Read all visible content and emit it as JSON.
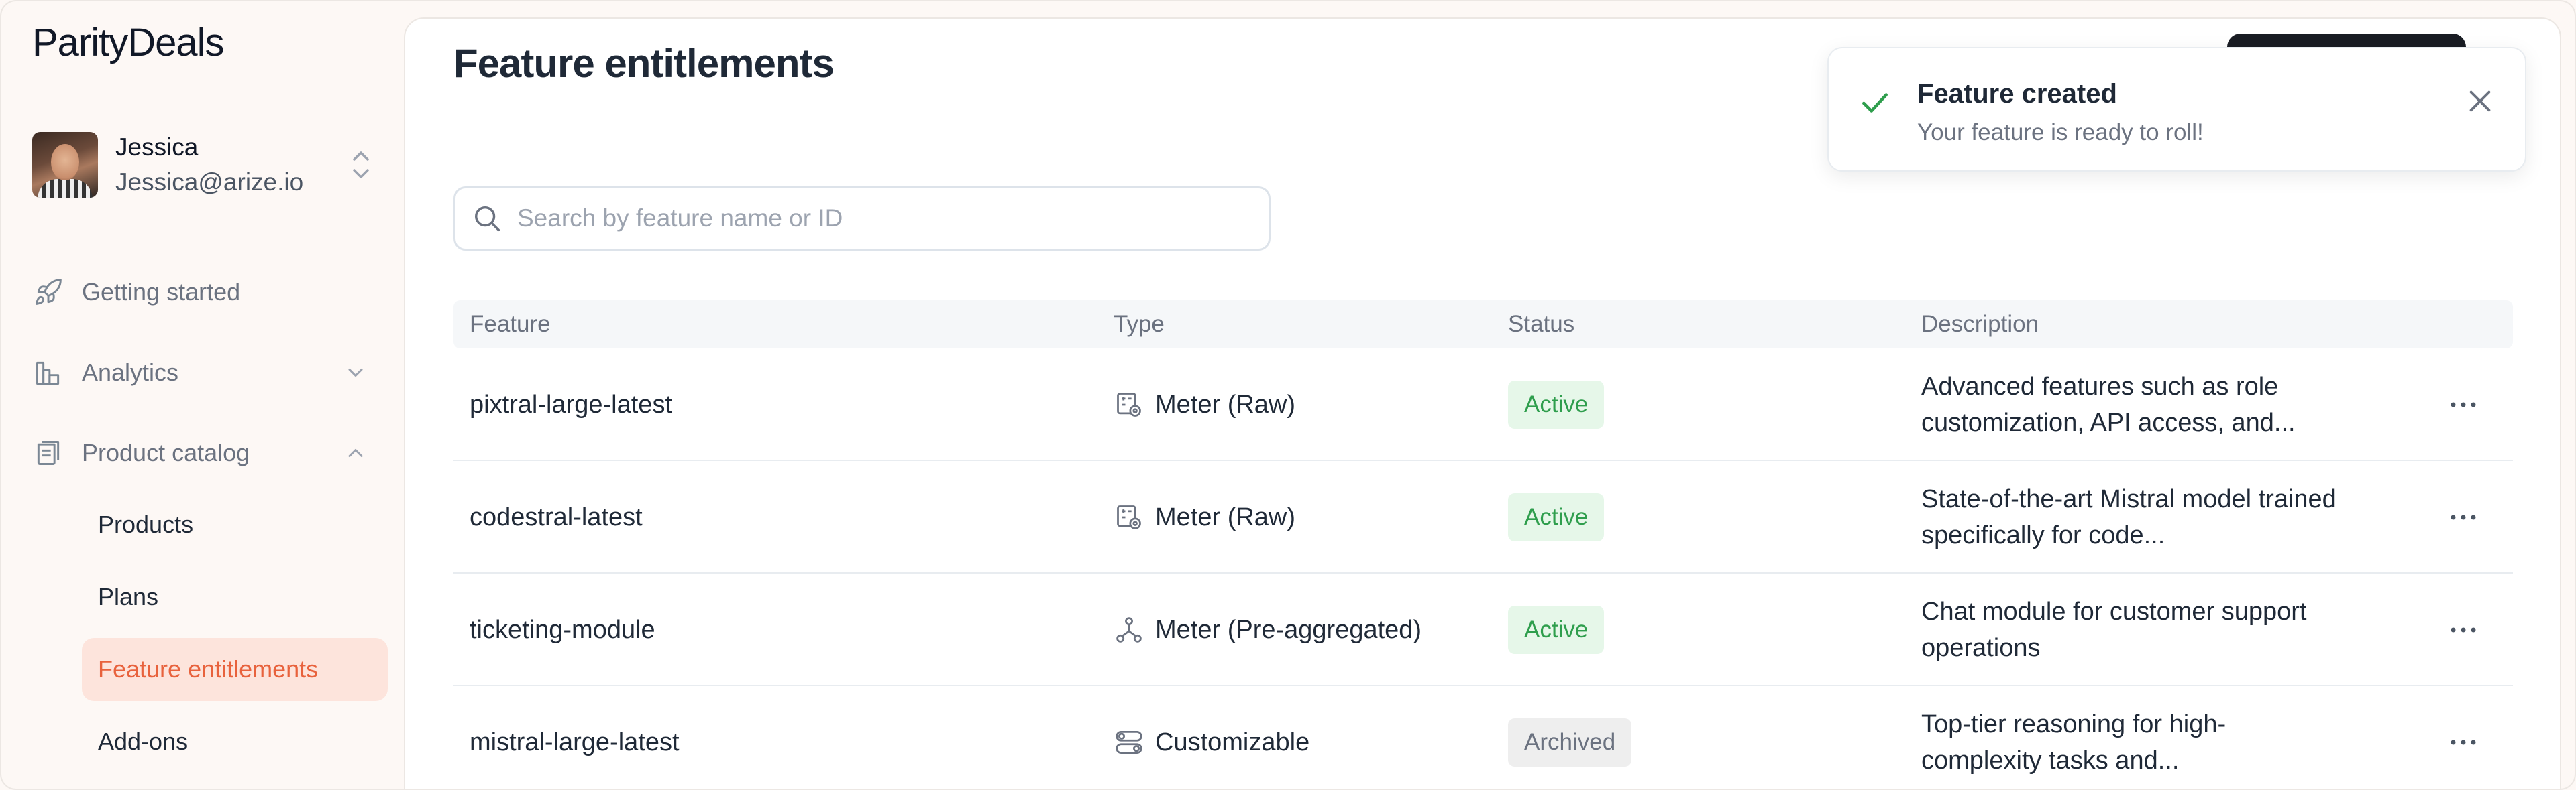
{
  "app": {
    "logo": "ParityDeals"
  },
  "user": {
    "name": "Jessica",
    "email": "Jessica@arize.io"
  },
  "sidebar": {
    "items": [
      {
        "label": "Getting started",
        "icon": "rocket-icon"
      },
      {
        "label": "Analytics",
        "icon": "chart-icon",
        "expanded": false
      },
      {
        "label": "Product catalog",
        "icon": "catalog-icon",
        "expanded": true
      }
    ],
    "sub_items": [
      {
        "label": "Products"
      },
      {
        "label": "Plans"
      },
      {
        "label": "Feature entitlements",
        "active": true
      },
      {
        "label": "Add-ons"
      }
    ]
  },
  "page": {
    "title": "Feature entitlements"
  },
  "search": {
    "placeholder": "Search by feature name or ID",
    "value": ""
  },
  "table": {
    "headers": {
      "feature": "Feature",
      "type": "Type",
      "status": "Status",
      "description": "Description"
    },
    "rows": [
      {
        "feature": "pixtral-large-latest",
        "type": "Meter (Raw)",
        "type_icon": "meter-icon",
        "status": "Active",
        "description": "Advanced features such as role customization, API access, and..."
      },
      {
        "feature": "codestral-latest",
        "type": "Meter (Raw)",
        "type_icon": "meter-icon",
        "status": "Active",
        "description": "State-of-the-art Mistral model trained specifically for code..."
      },
      {
        "feature": "ticketing-module",
        "type": "Meter (Pre-aggregated)",
        "type_icon": "aggregate-icon",
        "status": "Active",
        "description": "Chat module for customer support operations"
      },
      {
        "feature": "mistral-large-latest",
        "type": "Customizable",
        "type_icon": "toggle-icon",
        "status": "Archived",
        "description": "Top-tier reasoning for high-complexity tasks and..."
      }
    ]
  },
  "toast": {
    "title": "Feature created",
    "message": "Your feature is ready to roll!"
  },
  "colors": {
    "accent": "#e8623d",
    "active_bg": "#fde4dc",
    "success": "#2f9e4d",
    "dark_button": "#1a1d24"
  }
}
